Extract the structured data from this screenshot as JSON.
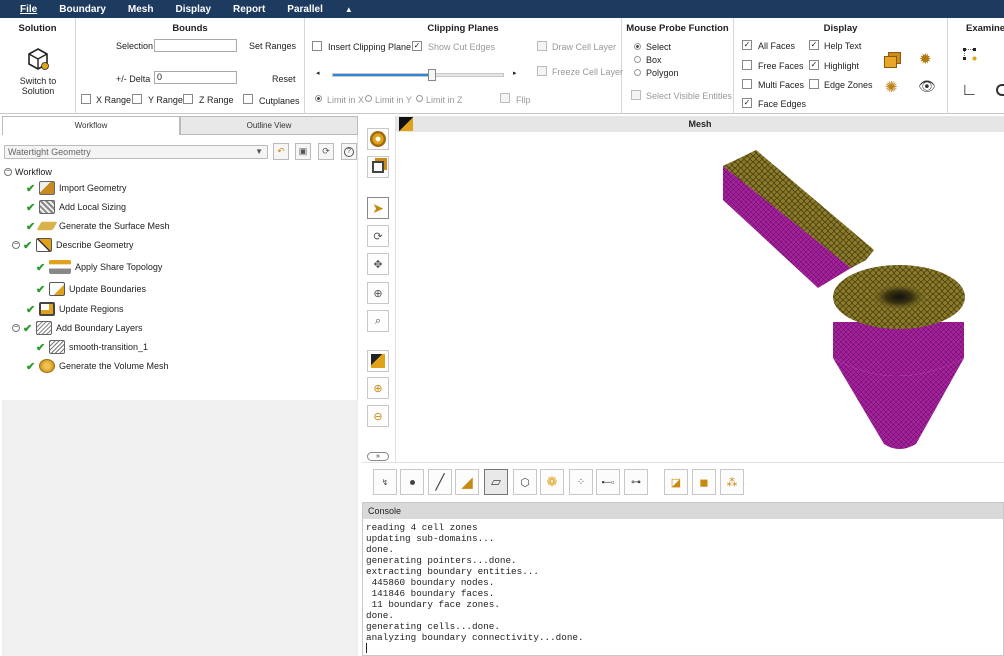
{
  "menu": [
    "File",
    "Boundary",
    "Mesh",
    "Display",
    "Report",
    "Parallel",
    "▲"
  ],
  "ribbon": {
    "solution": {
      "title": "Solution",
      "button_line1": "Switch to",
      "button_line2": "Solution"
    },
    "bounds": {
      "title": "Bounds",
      "selection_label": "Selection",
      "selection_value": "",
      "set_ranges": "Set Ranges",
      "delta_label": "+/- Delta",
      "delta_value": "0",
      "reset": "Reset",
      "x_range": "X Range",
      "y_range": "Y Range",
      "z_range": "Z Range",
      "cutplanes": "Cutplanes"
    },
    "clipping": {
      "title": "Clipping Planes",
      "insert": "Insert Clipping Plane",
      "show_cut_edges": "Show Cut Edges",
      "draw_cell_layer": "Draw Cell Layer",
      "freeze_cell_layer": "Freeze Cell Layer",
      "limit_x": "Limit in X",
      "limit_y": "Limit in Y",
      "limit_z": "Limit in Z",
      "flip": "Flip",
      "slider_percent": 0.58
    },
    "probe": {
      "title": "Mouse Probe Function",
      "select": "Select",
      "box": "Box",
      "polygon": "Polygon",
      "select_visible": "Select Visible Entities"
    },
    "display": {
      "title": "Display",
      "all_faces": "All Faces",
      "free_faces": "Free Faces",
      "multi_faces": "Multi Faces",
      "face_edges": "Face Edges",
      "help_text": "Help Text",
      "highlight": "Highlight",
      "edge_zones": "Edge Zones"
    },
    "examine": {
      "title": "Examine"
    }
  },
  "left": {
    "tab_workflow": "Workflow",
    "tab_outline": "Outline View",
    "workflow_type": "Watertight Geometry",
    "root": "Workflow",
    "steps": [
      "Import Geometry",
      "Add Local Sizing",
      "Generate the Surface Mesh",
      "Describe Geometry",
      "Apply Share Topology",
      "Update Boundaries",
      "Update Regions",
      "Add Boundary Layers",
      "smooth-transition_1",
      "Generate the Volume Mesh"
    ]
  },
  "viewport": {
    "title": "Mesh"
  },
  "console": {
    "title": "Console",
    "lines": [
      "reading 4 cell zones",
      "updating sub-domains...",
      "done.",
      "generating pointers...done.",
      "extracting boundary entities...",
      " 445860 boundary nodes.",
      " 141846 boundary faces.",
      " 11 boundary face zones.",
      "done.",
      "generating cells...done.",
      "analyzing boundary connectivity...done."
    ]
  },
  "colors": {
    "menubar": "#1d3a5f",
    "face_yellow": "#8a7a2a",
    "face_magenta": "#a0229a",
    "check_green": "#2a9a2a"
  }
}
